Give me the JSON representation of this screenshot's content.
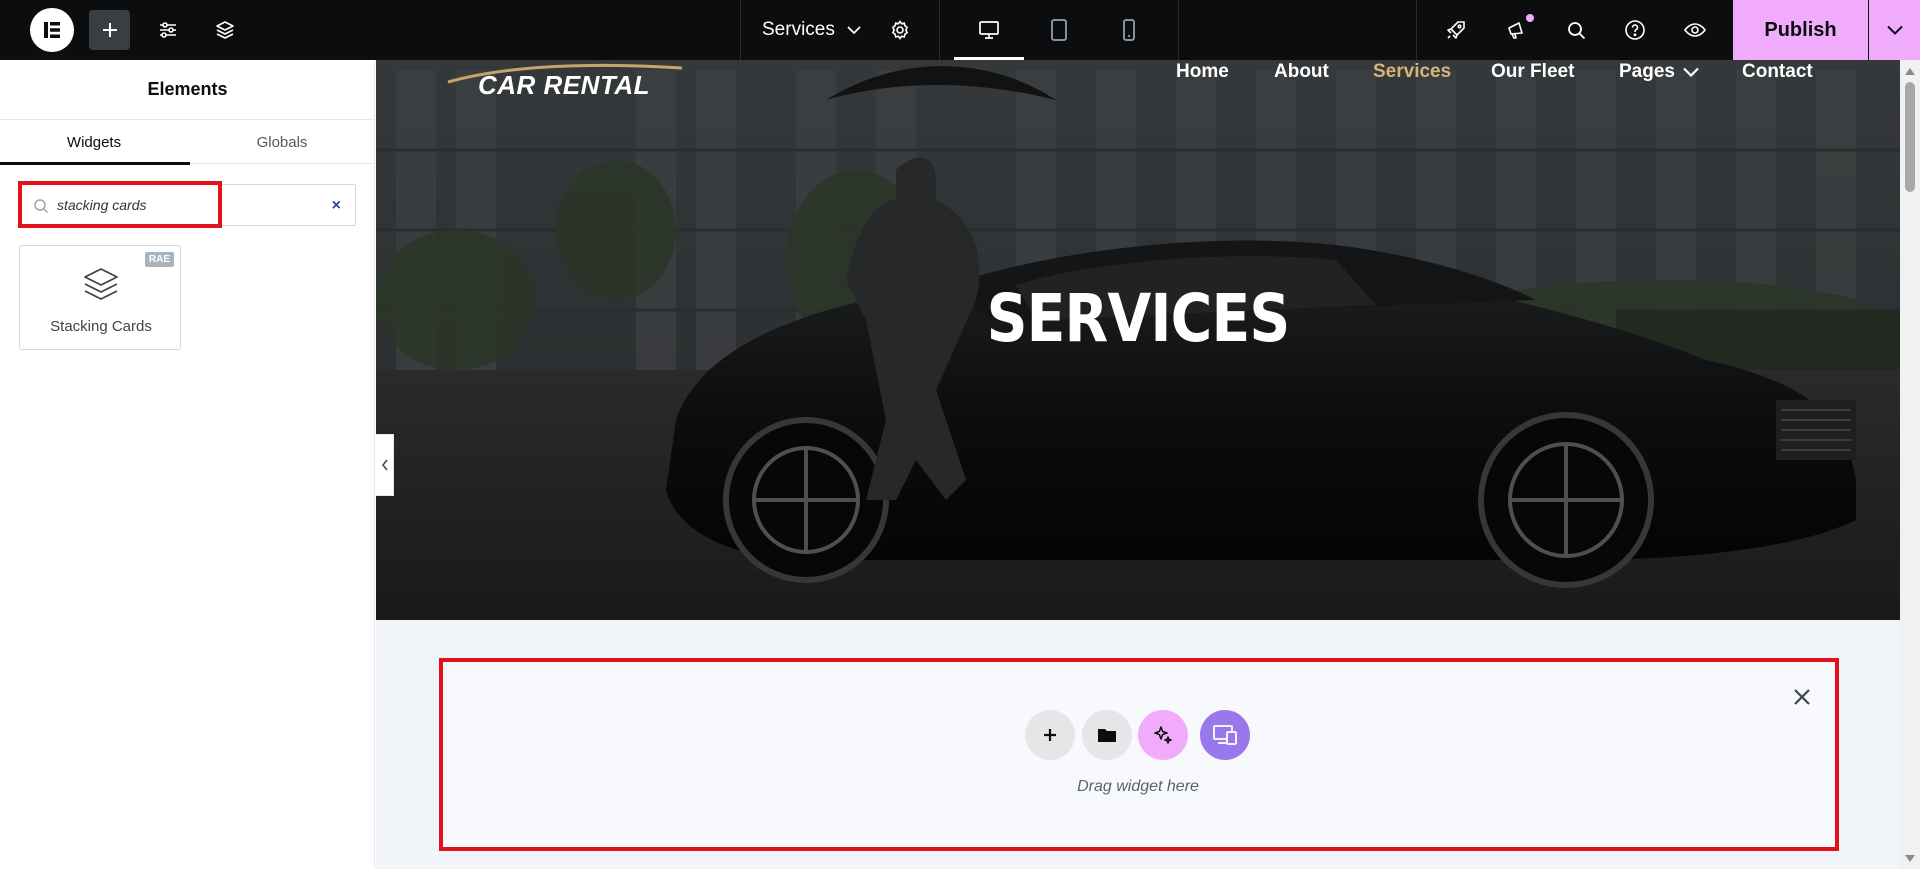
{
  "topbar": {
    "page_title": "Services",
    "publish_label": "Publish"
  },
  "panel": {
    "title": "Elements",
    "tabs": [
      {
        "label": "Widgets",
        "active": true
      },
      {
        "label": "Globals",
        "active": false
      }
    ],
    "search": {
      "value": "stacking cards",
      "clear_symbol": "×"
    },
    "widgets": [
      {
        "label": "Stacking Cards",
        "badge": "RAE",
        "icon": "layers-icon"
      }
    ]
  },
  "site": {
    "brand": "CAR RENTAL",
    "nav": [
      {
        "label": "Home",
        "active": false
      },
      {
        "label": "About",
        "active": false
      },
      {
        "label": "Services",
        "active": true
      },
      {
        "label": "Our Fleet",
        "active": false
      },
      {
        "label": "Pages",
        "active": false,
        "has_dropdown": true
      },
      {
        "label": "Contact",
        "active": false
      }
    ],
    "hero_title": "SERVICES"
  },
  "dropzone": {
    "text": "Drag widget here"
  },
  "colors": {
    "topbar_bg": "#0c0d0e",
    "publish_bg": "#f0abfc",
    "highlight": "#e0121b",
    "nav_active": "#d8b478",
    "ai_button": "#f0abfc",
    "responsive_button": "#9a77ea"
  }
}
